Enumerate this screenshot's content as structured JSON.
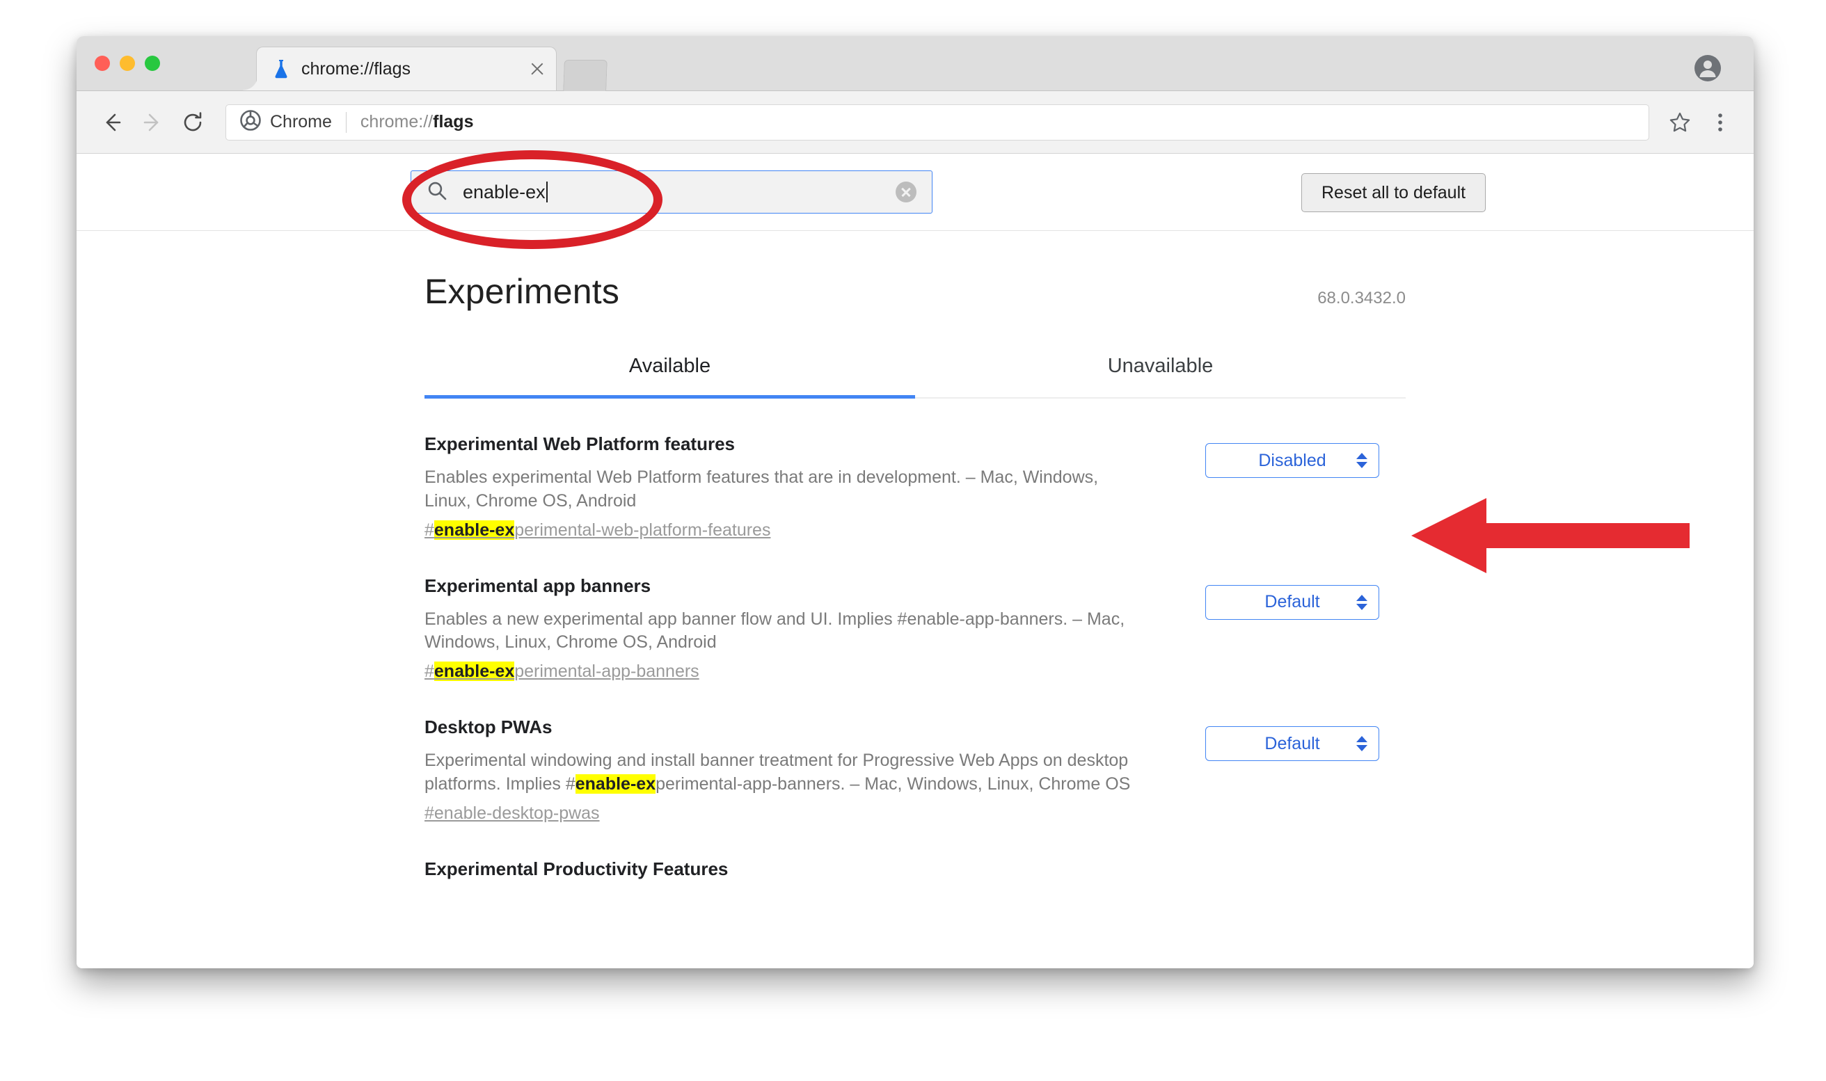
{
  "window": {
    "traffic_lights": [
      "close",
      "minimize",
      "maximize"
    ],
    "tab": {
      "favicon": "flask-icon",
      "title": "chrome://flags",
      "close_icon": "close-icon"
    },
    "avatar_icon": "account-avatar-icon"
  },
  "toolbar": {
    "back_icon": "back-arrow-icon",
    "forward_icon": "forward-arrow-icon",
    "reload_icon": "reload-icon",
    "security_chip_label": "Chrome",
    "security_chip_icon": "chrome-logo-icon",
    "url_prefix": "chrome://",
    "url_emphasis": "flags",
    "star_icon": "star-bookmark-icon",
    "menu_icon": "three-dot-menu-icon"
  },
  "search": {
    "icon": "search-icon",
    "value": "enable-ex",
    "clear_icon": "clear-x-icon",
    "reset_label": "Reset all to default"
  },
  "page": {
    "title": "Experiments",
    "version": "68.0.3432.0"
  },
  "tabs": [
    {
      "label": "Available",
      "active": true
    },
    {
      "label": "Unavailable",
      "active": false
    }
  ],
  "experiments": [
    {
      "title": "Experimental Web Platform features",
      "desc_line1": "Enables experimental Web Platform features that are in development. – Mac, Windows,",
      "desc_line2": "Linux, Chrome OS, Android",
      "desc_highlight": "",
      "link_prefix": "#",
      "link_highlight": "enable-ex",
      "link_suffix": "perimental-web-platform-features",
      "select_value": "Disabled"
    },
    {
      "title": "Experimental app banners",
      "desc_line1": "Enables a new experimental app banner flow and UI. Implies #enable-app-banners. – Mac,",
      "desc_line2": "Windows, Linux, Chrome OS, Android",
      "desc_highlight": "",
      "link_prefix": "#",
      "link_highlight": "enable-ex",
      "link_suffix": "perimental-app-banners",
      "select_value": "Default"
    },
    {
      "title": "Desktop PWAs",
      "desc_line1": "Experimental windowing and install banner treatment for Progressive Web Apps on desktop",
      "desc_line2_pre": "platforms. Implies #",
      "desc_highlight": "enable-ex",
      "desc_line2_post": "perimental-app-banners. – Mac, Windows, Linux, Chrome OS",
      "link_prefix": "#enable-desktop-pwas",
      "link_highlight": "",
      "link_suffix": "",
      "select_value": "Default"
    },
    {
      "title": "Experimental Productivity Features",
      "desc_line1": "",
      "desc_line2": "",
      "link_prefix": "",
      "link_highlight": "",
      "link_suffix": "",
      "select_value": ""
    }
  ],
  "annotations": {
    "ellipse_color": "#d92128",
    "arrow_color": "#e52b31",
    "ellipse_target": "search-input",
    "arrow_target": "first-experiment-select"
  }
}
